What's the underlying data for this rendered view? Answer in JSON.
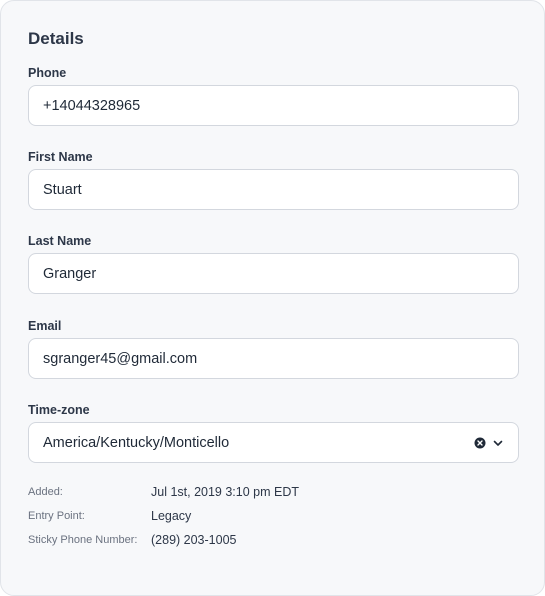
{
  "details": {
    "title": "Details",
    "fields": {
      "phone": {
        "label": "Phone",
        "value": "+14044328965"
      },
      "first_name": {
        "label": "First Name",
        "value": "Stuart"
      },
      "last_name": {
        "label": "Last Name",
        "value": "Granger"
      },
      "email": {
        "label": "Email",
        "value": "sgranger45@gmail.com"
      },
      "timezone": {
        "label": "Time-zone",
        "value": "America/Kentucky/Monticello"
      }
    },
    "meta": {
      "added": {
        "label": "Added:",
        "value": "Jul 1st, 2019 3:10 pm EDT"
      },
      "entry_point": {
        "label": "Entry Point:",
        "value": "Legacy"
      },
      "sticky_phone": {
        "label": "Sticky Phone Number:",
        "value": "(289) 203-1005"
      }
    },
    "icons": {
      "clear": "clear-icon",
      "chevron": "chevron-down-icon"
    }
  }
}
